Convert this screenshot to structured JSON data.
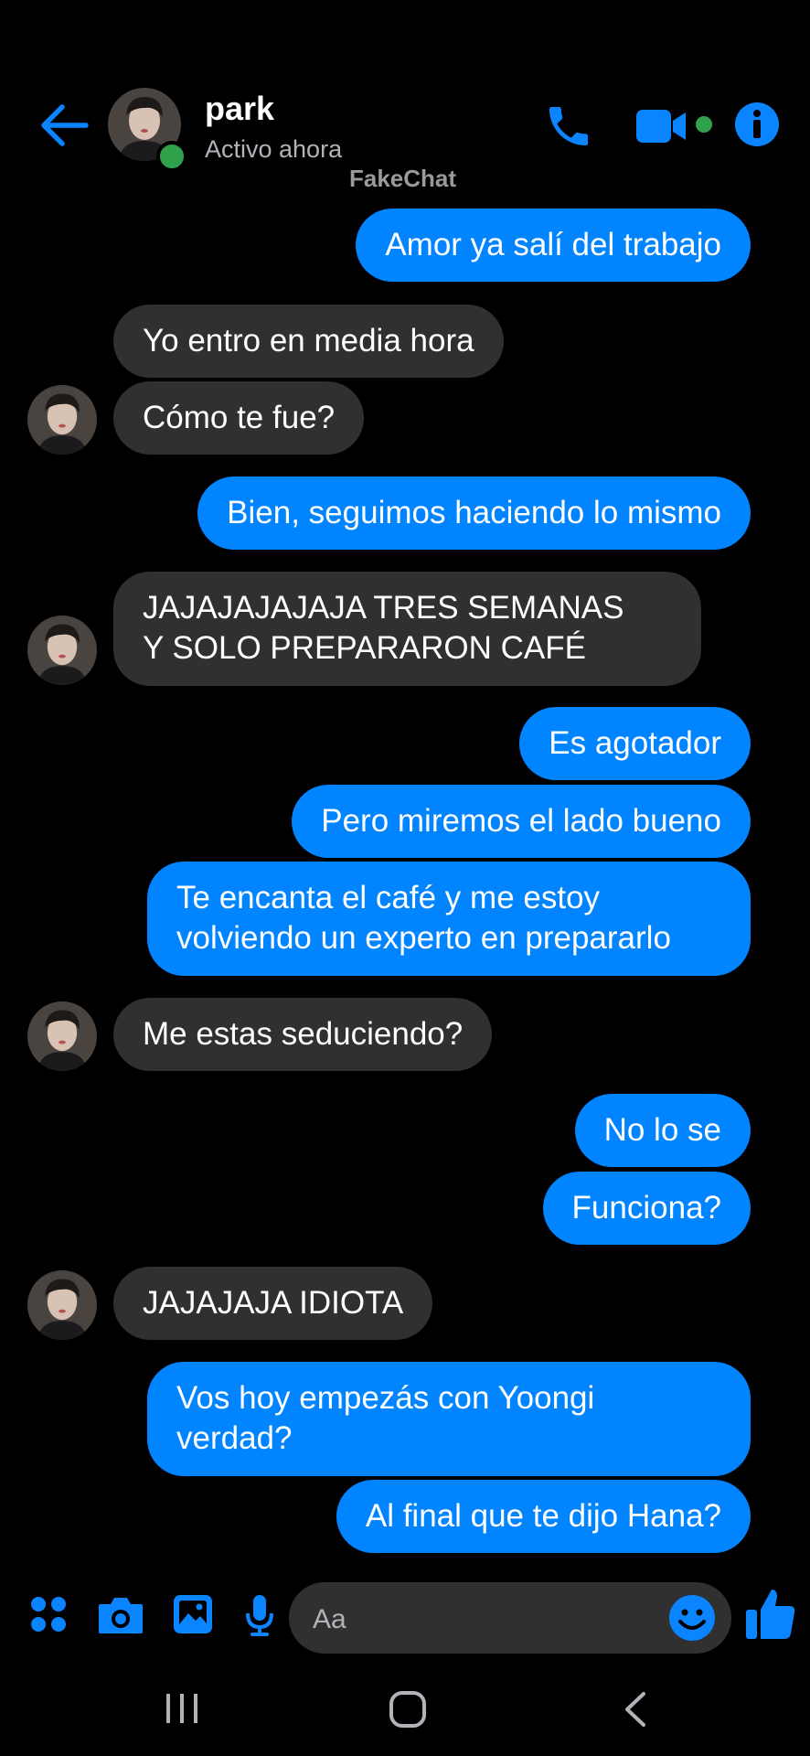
{
  "header": {
    "back_icon": "arrow-left-icon",
    "contact_name": "park",
    "status": "Activo ahora",
    "watermark": "FakeChat",
    "call_icon": "phone-icon",
    "video_icon": "video-camera-icon",
    "info_icon": "info-icon"
  },
  "messages": [
    {
      "from": "me",
      "text": "Amor ya salí del trabajo"
    },
    {
      "from": "them",
      "text": "Yo entro en media hora"
    },
    {
      "from": "them",
      "text": "Cómo te fue?"
    },
    {
      "from": "me",
      "text": "Bien, seguimos haciendo lo mismo"
    },
    {
      "from": "them",
      "text": "JAJAJAJAJAJA TRES SEMANAS\nY SOLO PREPARARON CAFÉ"
    },
    {
      "from": "me",
      "text": "Es agotador"
    },
    {
      "from": "me",
      "text": "Pero miremos el lado bueno"
    },
    {
      "from": "me",
      "text": "Te encanta el café y me estoy\nvolviendo un experto en prepararlo"
    },
    {
      "from": "them",
      "text": "Me estas seduciendo?"
    },
    {
      "from": "me",
      "text": "No lo se"
    },
    {
      "from": "me",
      "text": "Funciona?"
    },
    {
      "from": "them",
      "text": "JAJAJAJA IDIOTA"
    },
    {
      "from": "me",
      "text": "Vos hoy empezás con Yoongi\nverdad?"
    },
    {
      "from": "me",
      "text": "Al final que te dijo Hana?"
    }
  ],
  "composer": {
    "placeholder": "Aa",
    "icons": [
      "apps-icon",
      "camera-icon",
      "gallery-icon",
      "microphone-icon",
      "emoji-icon",
      "thumbs-up-icon"
    ]
  },
  "colors": {
    "accent": "#0084ff",
    "incoming_bubble": "#303030",
    "online": "#31a24c",
    "background": "#000000"
  }
}
